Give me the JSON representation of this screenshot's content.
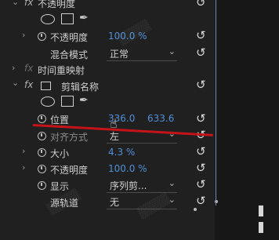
{
  "opacity_top": {
    "title": "不透明度"
  },
  "opacity_1": {
    "label": "不透明度",
    "value": "100.0 %"
  },
  "blend": {
    "label": "混合模式",
    "value": "正常"
  },
  "time_remap": {
    "label": "时间重映射"
  },
  "clip_name": {
    "label": "剪辑名称"
  },
  "position": {
    "label": "位置",
    "x": "336.0",
    "y": "633.6"
  },
  "align": {
    "label": "对齐方式",
    "value": "左"
  },
  "size": {
    "label": "大小",
    "value": "4.3 %"
  },
  "opacity_2": {
    "label": "不透明度",
    "value": "100.0 %"
  },
  "display": {
    "label": "显示",
    "value": "序列剪..."
  },
  "source_track": {
    "label": "源轨道",
    "value": "无"
  },
  "fx_label": "fx",
  "colors": {
    "value_blue": "#4f8fd8",
    "annotation_red": "#c4141a",
    "panel_bg": "#202020"
  },
  "icons": {
    "reset": "reset-icon",
    "stopwatch": "stopwatch-icon",
    "pen": "pen-icon"
  }
}
